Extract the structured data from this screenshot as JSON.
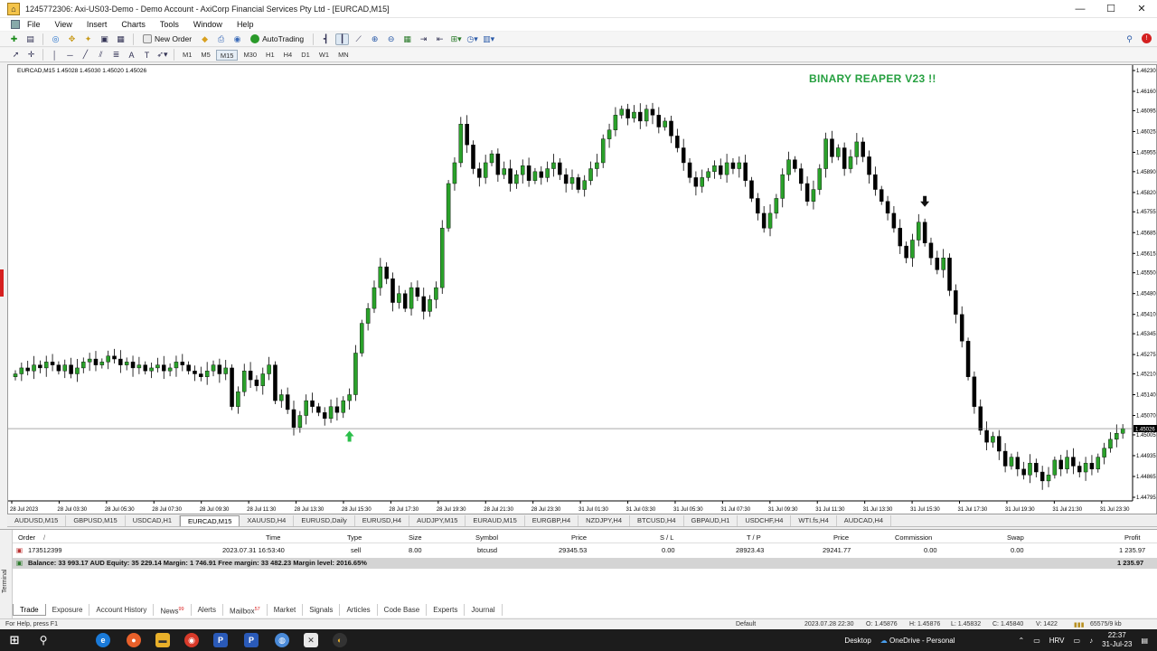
{
  "window": {
    "title": "1245772306: Axi-US03-Demo - Demo Account - AxiCorp Financial Services Pty Ltd - [EURCAD,M15]",
    "controls": [
      "—",
      "☐",
      "✕"
    ]
  },
  "menu": [
    "File",
    "View",
    "Insert",
    "Charts",
    "Tools",
    "Window",
    "Help"
  ],
  "toolbar": {
    "new_order": "New Order",
    "auto_trading": "AutoTrading"
  },
  "timeframes": [
    "M1",
    "M5",
    "M15",
    "M30",
    "H1",
    "H4",
    "D1",
    "W1",
    "MN"
  ],
  "active_timeframe": "M15",
  "chart": {
    "symbol_label": "EURCAD,M15  1.45028 1.45030 1.45020 1.45026",
    "banner": "BINARY REAPER V23 !!",
    "current_price": "1.45026",
    "up_color": "#2aa12a",
    "down_color": "#000000",
    "arrow_up_color": "#2bbf4a",
    "arrow_down_color": "#111111"
  },
  "chart_data": {
    "type": "candlestick",
    "price_labels": [
      "1.46230",
      "1.46160",
      "1.46095",
      "1.46025",
      "1.45955",
      "1.45890",
      "1.45820",
      "1.45755",
      "1.45685",
      "1.45615",
      "1.45550",
      "1.45480",
      "1.45410",
      "1.45345",
      "1.45275",
      "1.45210",
      "1.45140",
      "1.45070",
      "1.45005",
      "1.44935",
      "1.44865",
      "1.44795"
    ],
    "ylim": [
      1.44795,
      1.4623
    ],
    "time_labels": [
      "28 Jul 2023",
      "28 Jul 03:30",
      "28 Jul 05:30",
      "28 Jul 07:30",
      "28 Jul 09:30",
      "28 Jul 11:30",
      "28 Jul 13:30",
      "28 Jul 15:30",
      "28 Jul 17:30",
      "28 Jul 19:30",
      "28 Jul 21:30",
      "28 Jul 23:30",
      "31 Jul 01:30",
      "31 Jul 03:30",
      "31 Jul 05:30",
      "31 Jul 07:30",
      "31 Jul 09:30",
      "31 Jul 11:30",
      "31 Jul 13:30",
      "31 Jul 15:30",
      "31 Jul 17:30",
      "31 Jul 19:30",
      "31 Jul 21:30",
      "31 Jul 23:30"
    ],
    "closes": [
      1.4521,
      1.4523,
      1.4522,
      1.4524,
      1.4523,
      1.4525,
      1.4524,
      1.4522,
      1.4524,
      1.4521,
      1.4523,
      1.4525,
      1.4526,
      1.4524,
      1.4525,
      1.4527,
      1.4526,
      1.4524,
      1.4525,
      1.4523,
      1.4524,
      1.4522,
      1.4523,
      1.4524,
      1.4522,
      1.4523,
      1.4525,
      1.4524,
      1.4522,
      1.4521,
      1.452,
      1.4522,
      1.4524,
      1.4521,
      1.4523,
      1.451,
      1.4515,
      1.4522,
      1.4519,
      1.4517,
      1.4521,
      1.4524,
      1.4512,
      1.4514,
      1.4509,
      1.4503,
      1.4507,
      1.4512,
      1.451,
      1.4508,
      1.4506,
      1.451,
      1.4508,
      1.4512,
      1.4514,
      1.4528,
      1.4538,
      1.4543,
      1.455,
      1.4557,
      1.4553,
      1.4545,
      1.4548,
      1.4543,
      1.455,
      1.4547,
      1.4542,
      1.4546,
      1.455,
      1.457,
      1.4585,
      1.4592,
      1.4605,
      1.4598,
      1.459,
      1.4587,
      1.4592,
      1.4595,
      1.4588,
      1.459,
      1.4585,
      1.4588,
      1.4591,
      1.4586,
      1.4589,
      1.4587,
      1.459,
      1.4592,
      1.4588,
      1.4585,
      1.4587,
      1.4583,
      1.4586,
      1.459,
      1.4592,
      1.46,
      1.4603,
      1.4608,
      1.461,
      1.4607,
      1.4609,
      1.4606,
      1.461,
      1.4608,
      1.4604,
      1.4606,
      1.4601,
      1.4597,
      1.4592,
      1.4587,
      1.4584,
      1.4587,
      1.4589,
      1.4591,
      1.4588,
      1.4592,
      1.459,
      1.4592,
      1.4586,
      1.458,
      1.4575,
      1.457,
      1.4575,
      1.458,
      1.4588,
      1.4593,
      1.459,
      1.4585,
      1.4579,
      1.4583,
      1.459,
      1.46,
      1.4594,
      1.4597,
      1.459,
      1.4594,
      1.4599,
      1.4594,
      1.4588,
      1.4583,
      1.4579,
      1.4575,
      1.457,
      1.4564,
      1.456,
      1.4566,
      1.4572,
      1.4565,
      1.456,
      1.4556,
      1.456,
      1.4549,
      1.4541,
      1.4532,
      1.452,
      1.451,
      1.4502,
      1.4498,
      1.45,
      1.4495,
      1.449,
      1.4493,
      1.4489,
      1.4487,
      1.4491,
      1.4488,
      1.4485,
      1.4487,
      1.4492,
      1.4489,
      1.4493,
      1.449,
      1.4488,
      1.4491,
      1.4489,
      1.4493,
      1.4496,
      1.4499,
      1.4501,
      1.45026
    ],
    "signals": [
      {
        "type": "buy",
        "bar_index": 54
      },
      {
        "type": "sell",
        "bar_index": 147
      }
    ]
  },
  "symbol_tabs": [
    "AUDUSD,M15",
    "GBPUSD,M15",
    "USDCAD,H1",
    "EURCAD,M15",
    "XAUUSD,H4",
    "EURUSD,Daily",
    "EURUSD,H4",
    "AUDJPY,M15",
    "EURAUD,M15",
    "EURGBP,H4",
    "NZDJPY,H4",
    "BTCUSD,H4",
    "GBPAUD,H1",
    "USDCHF,H4",
    "WTI.fs,H4",
    "AUDCAD,H4"
  ],
  "active_symbol_tab": "EURCAD,M15",
  "terminal": {
    "side_label": "Terminal",
    "columns": [
      "Order",
      "/",
      "Time",
      "Type",
      "Size",
      "Symbol",
      "Price",
      "S / L",
      "T / P",
      "Price",
      "Commission",
      "Swap",
      "Profit"
    ],
    "rows": [
      [
        "173512399",
        "",
        "2023.07.31 16:53:40",
        "sell",
        "8.00",
        "btcusd",
        "29345.53",
        "0.00",
        "28923.43",
        "29241.77",
        "0.00",
        "0.00",
        "1 235.97"
      ]
    ],
    "balance_line": "Balance: 33 993.17 AUD  Equity: 35 229.14  Margin: 1 746.91  Free margin: 33 482.23  Margin level: 2016.65%",
    "balance_profit": "1 235.97",
    "tabs": [
      {
        "label": "Trade",
        "badge": ""
      },
      {
        "label": "Exposure",
        "badge": ""
      },
      {
        "label": "Account History",
        "badge": ""
      },
      {
        "label": "News",
        "badge": "99"
      },
      {
        "label": "Alerts",
        "badge": ""
      },
      {
        "label": "Mailbox",
        "badge": "57"
      },
      {
        "label": "Market",
        "badge": ""
      },
      {
        "label": "Signals",
        "badge": ""
      },
      {
        "label": "Articles",
        "badge": ""
      },
      {
        "label": "Code Base",
        "badge": ""
      },
      {
        "label": "Experts",
        "badge": ""
      },
      {
        "label": "Journal",
        "badge": ""
      }
    ],
    "active_tab": "Trade"
  },
  "status": {
    "help": "For Help, press F1",
    "profile": "Default",
    "datetime": "2023.07.28 22:30",
    "open": "O: 1.45876",
    "high": "H: 1.45876",
    "low": "L: 1.45832",
    "close": "C: 1.45840",
    "volume": "V: 1422",
    "traffic": "65575/9 kb"
  },
  "taskbar": {
    "desktop": "Desktop",
    "onedrive": "OneDrive - Personal",
    "lang": "HRV",
    "time": "22:37",
    "date": "31-Jul-23"
  }
}
